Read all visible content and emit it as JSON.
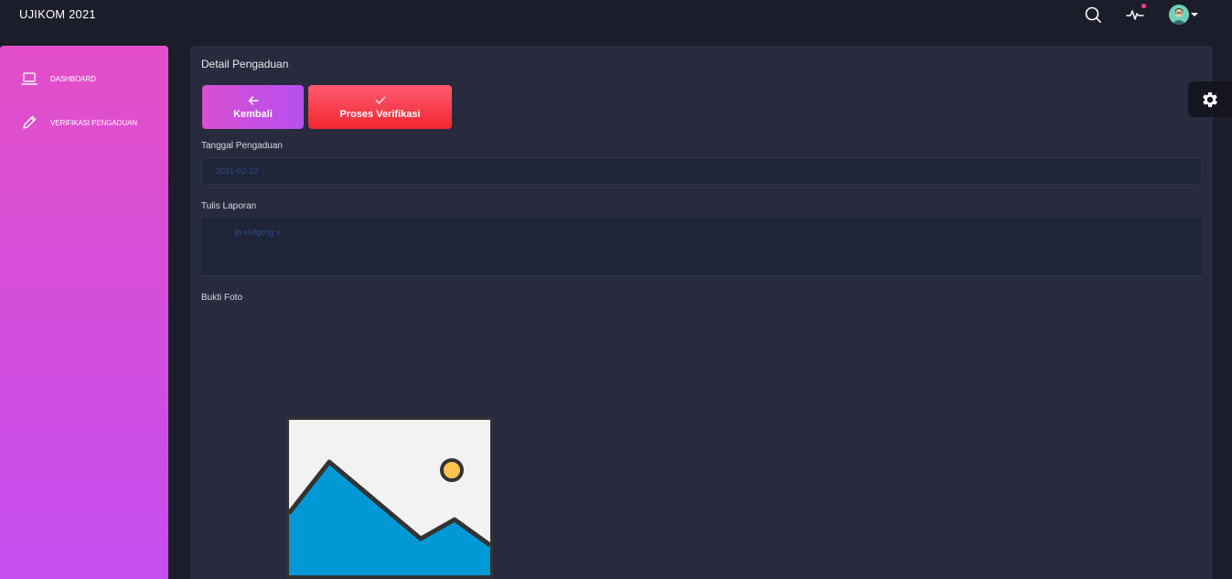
{
  "app": {
    "title": "UJIKOM 2021"
  },
  "topbar": {
    "icons": [
      "search-icon",
      "activity-icon",
      "avatar"
    ],
    "notification_color": "#ff3d8b"
  },
  "sidebar": {
    "gradient": [
      "#e34ec8",
      "#c54ef0"
    ],
    "items": [
      {
        "label": "DASHBOARD",
        "icon": "laptop-icon"
      },
      {
        "label": "VERIFIKASI PENGADUAN",
        "icon": "pencil-icon"
      }
    ]
  },
  "main": {
    "title": "Detail Pengaduan",
    "buttons": {
      "back_label": "Kembali",
      "back_icon": "arrow-left-icon",
      "verify_label": "Proses Verifikasi",
      "verify_icon": "check-icon"
    },
    "fields": {
      "date_label": "Tanggal Pengaduan",
      "date_value": "2021-02-22",
      "report_label": "Tulis Laporan",
      "report_value": "jb xlxfgchg v",
      "photo_label": "Bukti Foto",
      "photo_icon": "image-placeholder-icon"
    }
  },
  "settings": {
    "icon": "gear-icon"
  }
}
